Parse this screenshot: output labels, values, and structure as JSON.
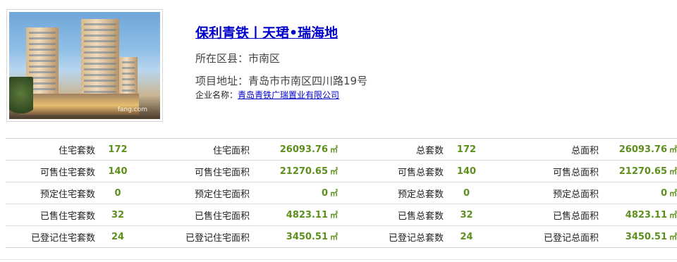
{
  "project": {
    "title": "保利青铁丨天珺•瑞海地",
    "district": "所在区县：市南区",
    "address": "项目地址：青岛市市南区四川路19号",
    "company_label": "企业名称：",
    "company_name": "青岛青铁广瑞置业有限公司",
    "photo_watermark": "fang.com"
  },
  "stats": {
    "rows": [
      {
        "l1": "住宅套数",
        "v1": "172",
        "l2": "住宅面积",
        "v2": "26093.76",
        "l3": "总套数",
        "v3": "172",
        "l4": "总面积",
        "v4": "26093.76"
      },
      {
        "l1": "可售住宅套数",
        "v1": "140",
        "l2": "可售住宅面积",
        "v2": "21270.65",
        "l3": "可售总套数",
        "v3": "140",
        "l4": "可售总面积",
        "v4": "21270.65"
      },
      {
        "l1": "预定住宅套数",
        "v1": "0",
        "l2": "预定住宅面积",
        "v2": "0",
        "l3": "预定总套数",
        "v3": "0",
        "l4": "预定总面积",
        "v4": "0"
      },
      {
        "l1": "已售住宅套数",
        "v1": "32",
        "l2": "已售住宅面积",
        "v2": "4823.11",
        "l3": "已售总套数",
        "v3": "32",
        "l4": "已售总面积",
        "v4": "4823.11"
      },
      {
        "l1": "已登记住宅套数",
        "v1": "24",
        "l2": "已登记住宅面积",
        "v2": "3450.51",
        "l3": "已登记总套数",
        "v3": "24",
        "l4": "已登记总面积",
        "v4": "3450.51"
      }
    ],
    "area_unit": "㎡"
  },
  "colors": {
    "link": "#0000cc",
    "value_green": "#5c8f1b"
  }
}
